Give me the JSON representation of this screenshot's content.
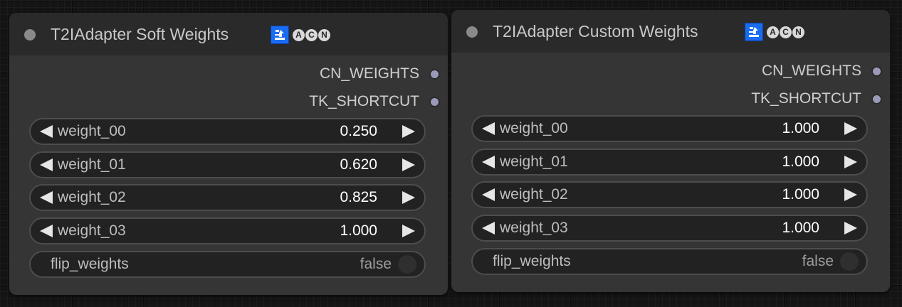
{
  "nodes": [
    {
      "title": "T2IAdapter Soft Weights",
      "badges": [
        "A",
        "C",
        "N"
      ],
      "pkg_icon": "download-badge-icon",
      "outputs": [
        "CN_WEIGHTS",
        "TK_SHORTCUT"
      ],
      "widgets": [
        {
          "label": "weight_00",
          "value": "0.250"
        },
        {
          "label": "weight_01",
          "value": "0.620"
        },
        {
          "label": "weight_02",
          "value": "0.825"
        },
        {
          "label": "weight_03",
          "value": "1.000"
        }
      ],
      "toggle": {
        "label": "flip_weights",
        "value": "false"
      }
    },
    {
      "title": "T2IAdapter Custom Weights",
      "badges": [
        "A",
        "C",
        "N"
      ],
      "pkg_icon": "download-badge-icon",
      "outputs": [
        "CN_WEIGHTS",
        "TK_SHORTCUT"
      ],
      "widgets": [
        {
          "label": "weight_00",
          "value": "1.000"
        },
        {
          "label": "weight_01",
          "value": "1.000"
        },
        {
          "label": "weight_02",
          "value": "1.000"
        },
        {
          "label": "weight_03",
          "value": "1.000"
        }
      ],
      "toggle": {
        "label": "flip_weights",
        "value": "false"
      }
    }
  ],
  "colors": {
    "canvas": "#141414",
    "node_body": "#353535",
    "node_header": "#2a2a2a",
    "widget_bg": "#222222",
    "slot": "#9a9ab8",
    "pkg_icon": "#1a6cf2"
  }
}
